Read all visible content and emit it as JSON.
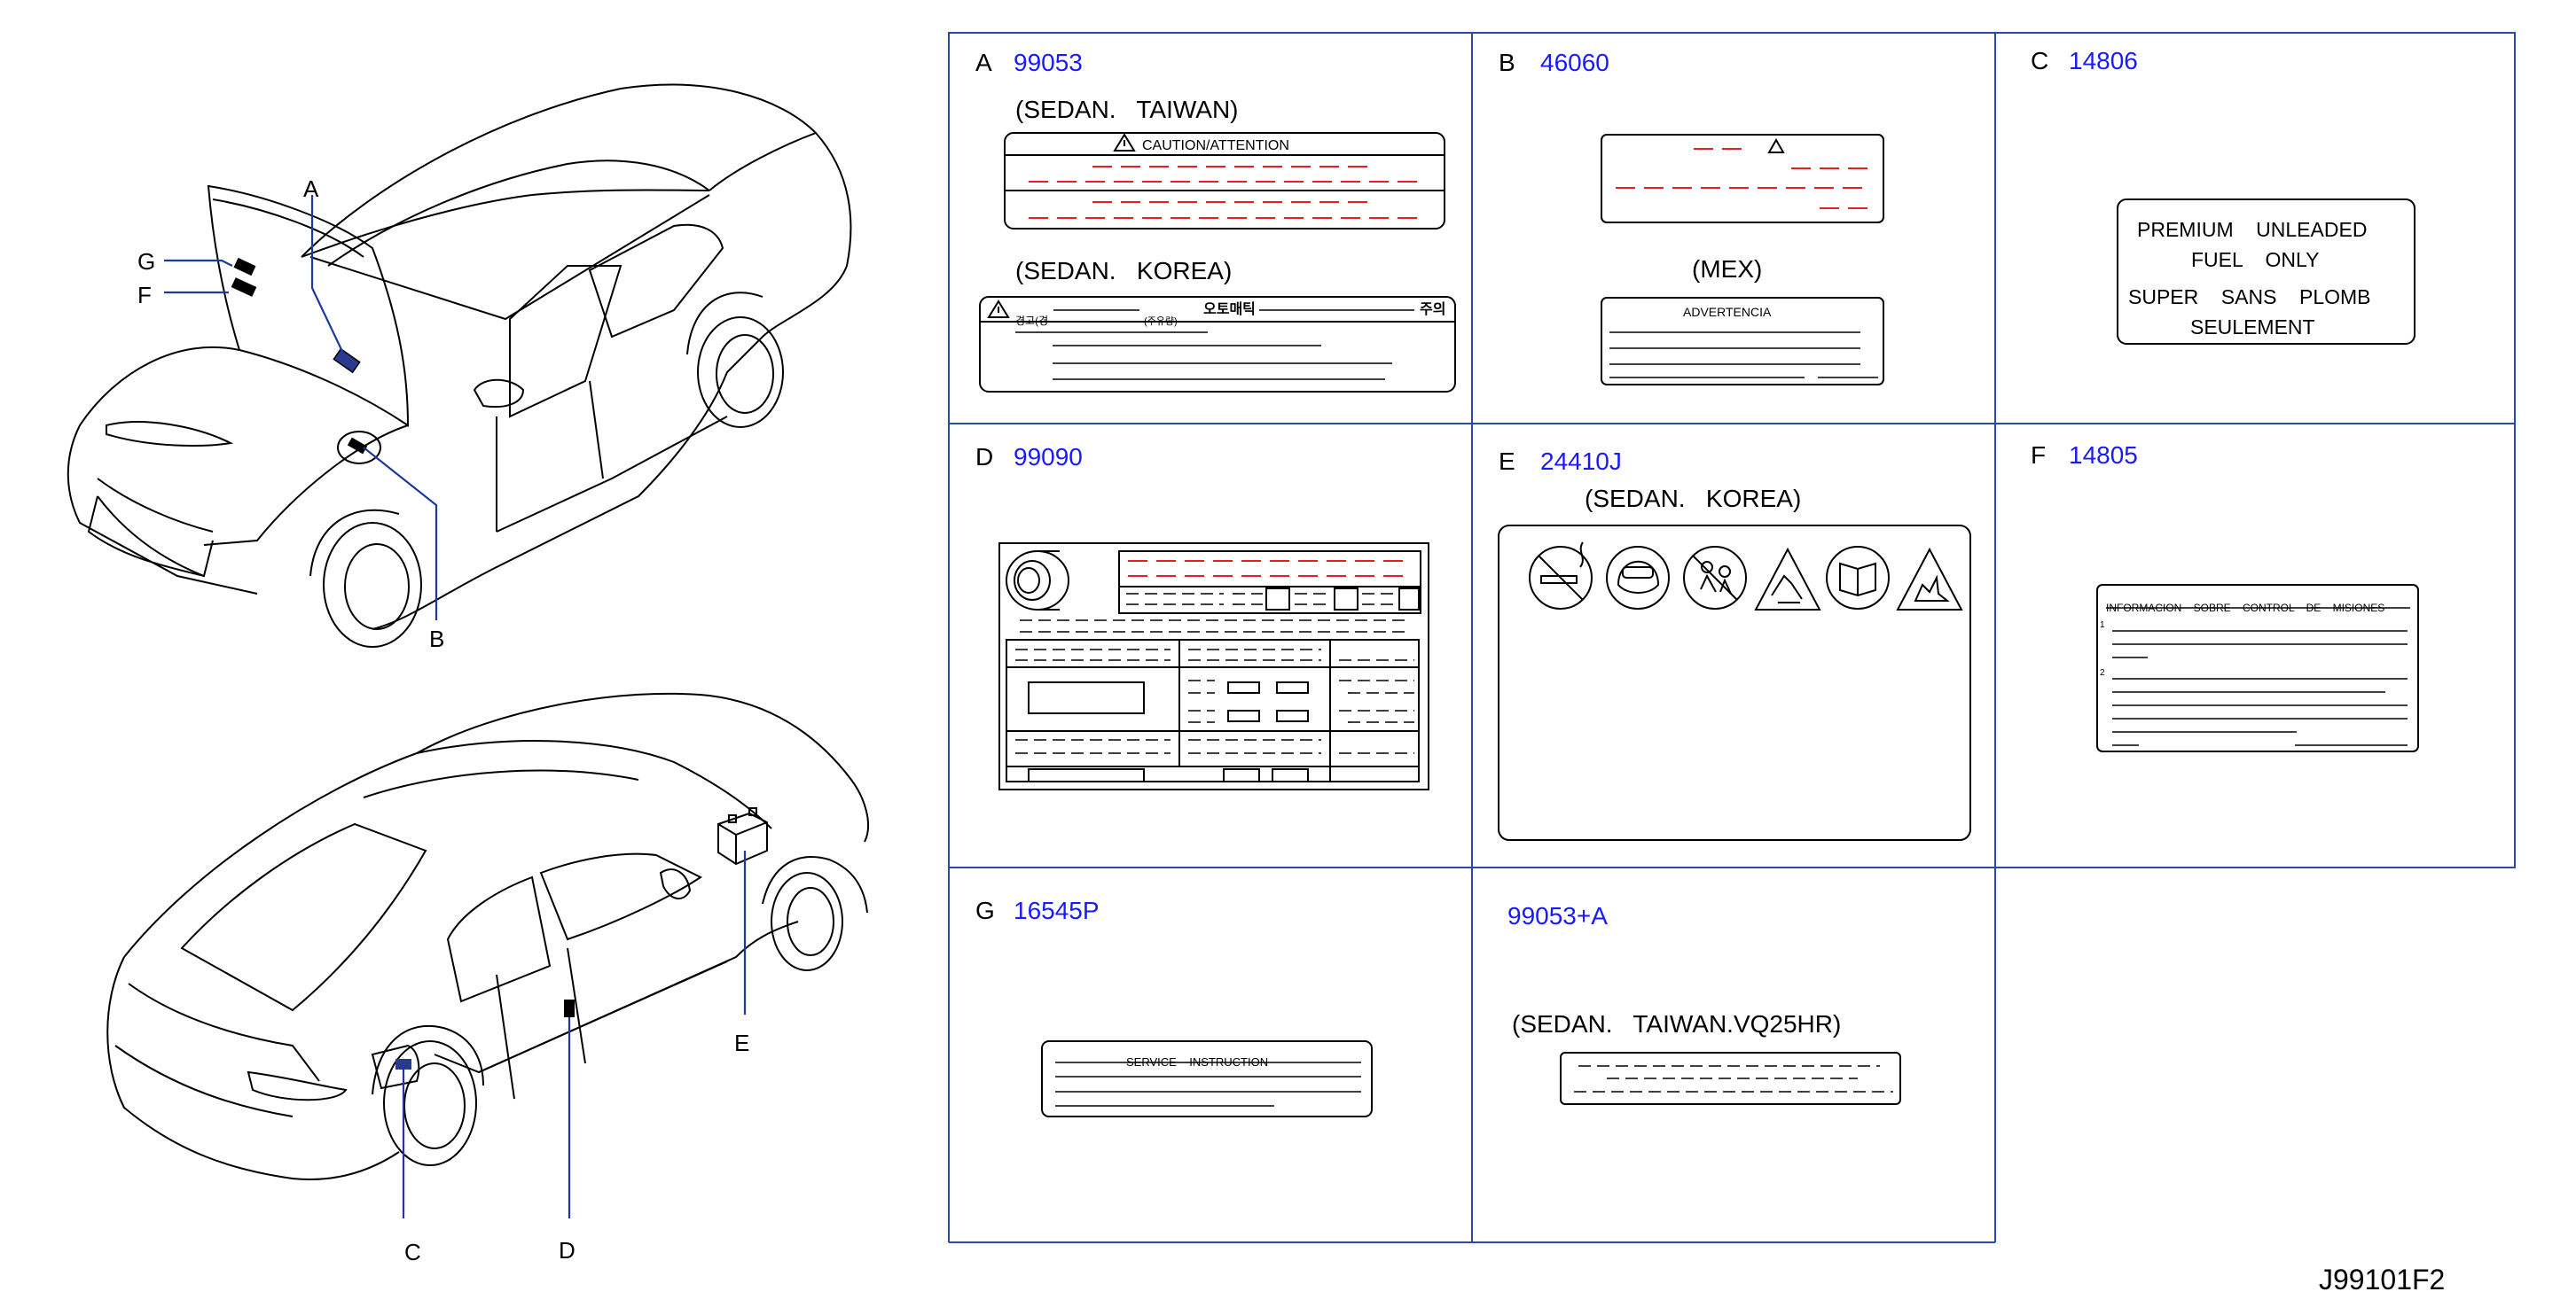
{
  "diagram_id": "J99101F2",
  "callouts": {
    "A": "A",
    "B": "B",
    "C": "C",
    "D": "D",
    "E": "E",
    "F": "F",
    "G": "G"
  },
  "cells": {
    "A": {
      "letter": "A",
      "part": "99053",
      "sub1": "(SEDAN.   TAIWAN)",
      "sub1_label": "CAUTION/ATTENTION",
      "sub2": "(SEDAN.   KOREA)",
      "sub2_label_left": "경고(경",
      "sub2_label_center": "오토매틱",
      "sub2_label_mid": "(주유량)",
      "sub2_label_right": "주의"
    },
    "B": {
      "letter": "B",
      "part": "46060",
      "sub": "(MEX)",
      "label": "ADVERTENCIA"
    },
    "C": {
      "letter": "C",
      "part": "14806",
      "lines": [
        "PREMIUM    UNLEADED",
        "FUEL    ONLY",
        "SUPER    SANS    PLOMB",
        "SEULEMENT"
      ]
    },
    "D": {
      "letter": "D",
      "part": "99090"
    },
    "E": {
      "letter": "E",
      "part": "24410J",
      "sub": "(SEDAN.   KOREA)"
    },
    "F": {
      "letter": "F",
      "part": "14805",
      "label": "INFORMACION    SOBRE    CONTROL    DE    MISIONES",
      "n1": "1",
      "n2": "2"
    },
    "G": {
      "letter": "G",
      "part": "16545P",
      "label": "SERVICE    INSTRUCTION"
    },
    "H": {
      "part": "99053+A",
      "sub": "(SEDAN.   TAIWAN.VQ25HR)"
    }
  },
  "icons": [
    "no-smoking-icon",
    "goggles-icon",
    "no-children-icon",
    "acid-warning-icon",
    "read-manual-icon",
    "explosion-warning-icon",
    "tire-icon",
    "warning-triangle-icon"
  ]
}
